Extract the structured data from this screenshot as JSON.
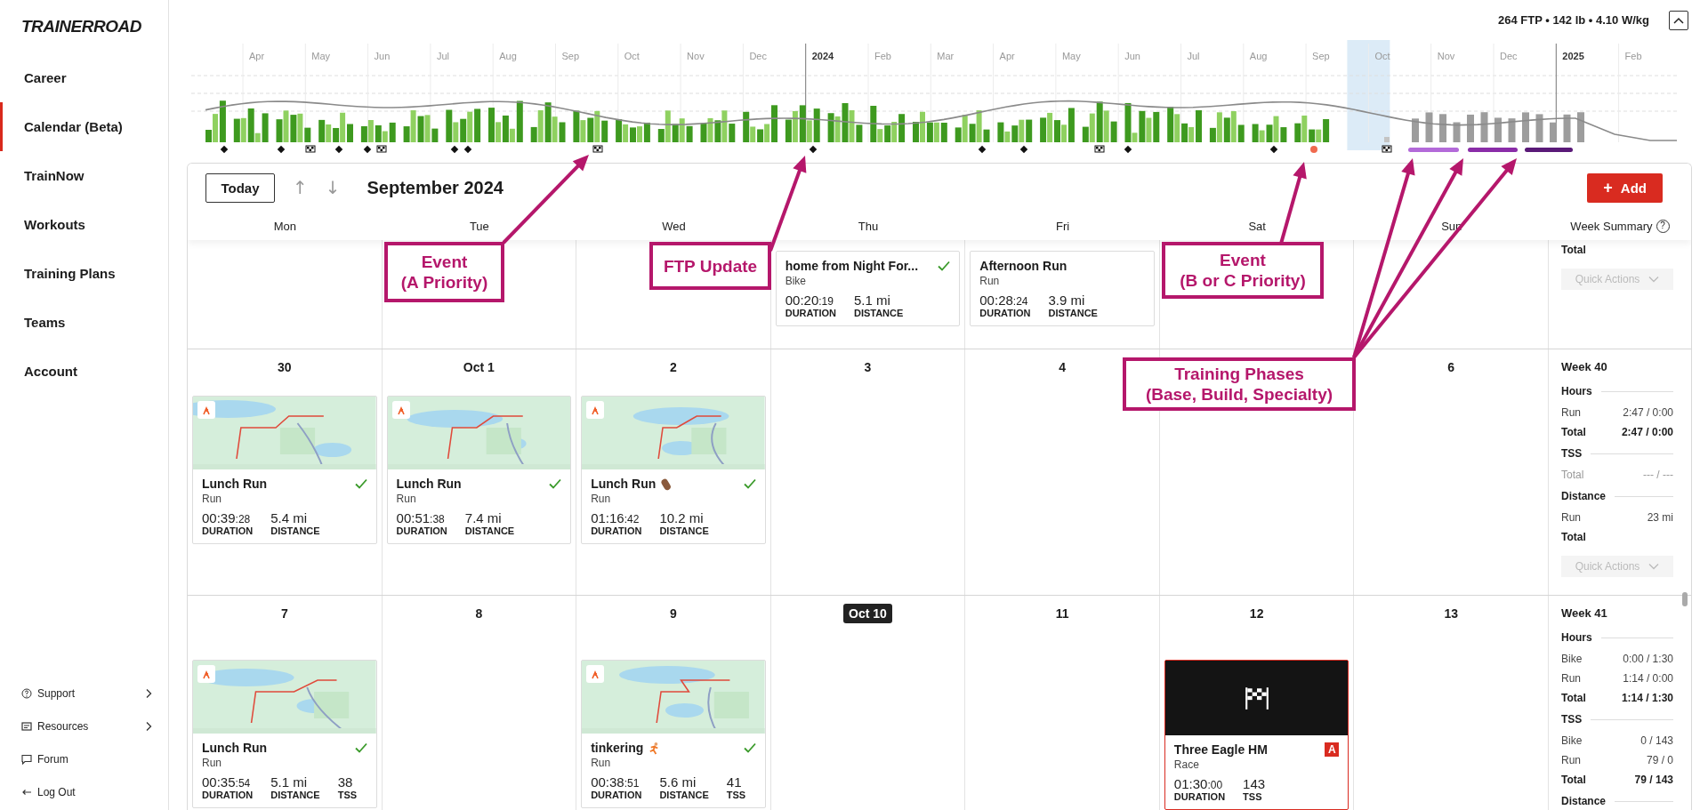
{
  "sidebar": {
    "logo": "TRAINERROAD",
    "nav": [
      {
        "label": "Career",
        "selected": false
      },
      {
        "label": "Calendar (Beta)",
        "selected": true
      },
      {
        "label": "TrainNow",
        "selected": false
      },
      {
        "label": "Workouts",
        "selected": false
      },
      {
        "label": "Training Plans",
        "selected": false
      },
      {
        "label": "Teams",
        "selected": false
      },
      {
        "label": "Account",
        "selected": false
      }
    ],
    "footer": [
      {
        "label": "Support",
        "kind": "help",
        "expandable": true
      },
      {
        "label": "Resources",
        "kind": "resources",
        "expandable": true
      },
      {
        "label": "Forum",
        "kind": "forum",
        "expandable": false
      },
      {
        "label": "Log Out",
        "kind": "logout",
        "expandable": false
      }
    ]
  },
  "header": {
    "stats": "264 FTP • 142 lb • 4.10 W/kg"
  },
  "timeline": {
    "months": [
      {
        "label": "Apr",
        "kind": "month",
        "selected": false
      },
      {
        "label": "May",
        "kind": "month",
        "selected": false
      },
      {
        "label": "Jun",
        "kind": "month",
        "selected": false
      },
      {
        "label": "Jul",
        "kind": "month",
        "selected": false
      },
      {
        "label": "Aug",
        "kind": "month",
        "selected": false
      },
      {
        "label": "Sep",
        "kind": "month",
        "selected": false
      },
      {
        "label": "Oct",
        "kind": "month",
        "selected": false
      },
      {
        "label": "Nov",
        "kind": "month",
        "selected": false
      },
      {
        "label": "Dec",
        "kind": "month",
        "selected": false
      },
      {
        "label": "2024",
        "kind": "year",
        "selected": false
      },
      {
        "label": "Feb",
        "kind": "month",
        "selected": false
      },
      {
        "label": "Mar",
        "kind": "month",
        "selected": false
      },
      {
        "label": "Apr",
        "kind": "month",
        "selected": false
      },
      {
        "label": "May",
        "kind": "month",
        "selected": false
      },
      {
        "label": "Jun",
        "kind": "month",
        "selected": false
      },
      {
        "label": "Jul",
        "kind": "month",
        "selected": false
      },
      {
        "label": "Aug",
        "kind": "month",
        "selected": false
      },
      {
        "label": "Sep",
        "kind": "month",
        "selected": false
      },
      {
        "label": "Oct",
        "kind": "month",
        "selected": true
      },
      {
        "label": "Nov",
        "kind": "month",
        "selected": false
      },
      {
        "label": "Dec",
        "kind": "month",
        "selected": false
      },
      {
        "label": "2025",
        "kind": "year",
        "selected": false
      },
      {
        "label": "Feb",
        "kind": "month",
        "selected": false
      }
    ]
  },
  "annotations": [
    {
      "text": "Event\n(A Priority)"
    },
    {
      "text": "FTP Update"
    },
    {
      "text": "Event\n(B or C Priority)"
    },
    {
      "text": "Training Phases\n(Base, Build, Specialty)"
    }
  ],
  "calendar": {
    "today_button": "Today",
    "prev": "↑",
    "next": "↓",
    "title": "September 2024",
    "add_icon": "+",
    "add_button": "Add",
    "weekdays": [
      "Mon",
      "Tue",
      "Wed",
      "Thu",
      "Fri",
      "Sat",
      "Sun"
    ],
    "summary_heading": "Week Summary",
    "help": "?",
    "weeks": [
      {
        "days": [
          {
            "today": false
          },
          {
            "today": false
          },
          {
            "today": false
          },
          {
            "today": false,
            "items": [
              {
                "kind": "activity",
                "title": "home from Night For...",
                "sport": "Bike",
                "completed": true,
                "stats": [
                  {
                    "kind": "time",
                    "value": "00:20:19",
                    "label": "DURATION"
                  },
                  {
                    "kind": "plain",
                    "value": "5.1 mi",
                    "label": "DISTANCE"
                  }
                ]
              }
            ]
          },
          {
            "today": false,
            "items": [
              {
                "kind": "activity",
                "title": "Afternoon Run",
                "sport": "Run",
                "completed": false,
                "stats": [
                  {
                    "kind": "time",
                    "value": "00:28:24",
                    "label": "DURATION"
                  },
                  {
                    "kind": "plain",
                    "value": "3.9 mi",
                    "label": "DISTANCE"
                  }
                ]
              }
            ]
          },
          {
            "today": false
          },
          {
            "today": false
          }
        ],
        "summary": [
          {
            "kind": "total",
            "label": "Total"
          }
        ],
        "quick_actions": {
          "label": "Quick Actions",
          "disabled": true
        }
      },
      {
        "days": [
          {
            "date": "30",
            "today": false,
            "items": [
              {
                "kind": "activity",
                "map": true,
                "title": "Lunch Run",
                "sport": "Run",
                "completed": true,
                "stats": [
                  {
                    "kind": "time",
                    "value": "00:39:28",
                    "label": "DURATION"
                  },
                  {
                    "kind": "plain",
                    "value": "5.4 mi",
                    "label": "DISTANCE"
                  }
                ]
              }
            ]
          },
          {
            "date": "Oct 1",
            "today": false,
            "items": [
              {
                "kind": "activity",
                "map": true,
                "title": "Lunch Run",
                "sport": "Run",
                "completed": true,
                "stats": [
                  {
                    "kind": "time",
                    "value": "00:51:38",
                    "label": "DURATION"
                  },
                  {
                    "kind": "plain",
                    "value": "7.4 mi",
                    "label": "DISTANCE"
                  }
                ]
              }
            ]
          },
          {
            "date": "2",
            "today": false,
            "items": [
              {
                "kind": "activity",
                "map": true,
                "title": "Lunch Run",
                "sport": "Run",
                "completed": true,
                "stats": [
                  {
                    "kind": "time",
                    "value": "01:16:42",
                    "label": "DURATION"
                  },
                  {
                    "kind": "plain",
                    "value": "10.2 mi",
                    "label": "DISTANCE"
                  }
                ]
              }
            ]
          },
          {
            "date": "3",
            "today": false
          },
          {
            "date": "4",
            "today": false
          },
          {
            "today": false
          },
          {
            "date": "6",
            "today": false
          }
        ],
        "summary": [
          {
            "kind": "title",
            "label": "Week 40"
          },
          {
            "kind": "heading",
            "label": "Hours"
          },
          {
            "kind": "row",
            "label": "Run",
            "value": "2:47 / 0:00"
          },
          {
            "kind": "total",
            "label": "Total",
            "value": "2:47 / 0:00"
          },
          {
            "kind": "heading",
            "label": "TSS"
          },
          {
            "kind": "muted",
            "label": "Total",
            "value": "--- / ---"
          },
          {
            "kind": "heading",
            "label": "Distance"
          },
          {
            "kind": "row",
            "label": "Run",
            "value": "23 mi"
          },
          {
            "kind": "total",
            "label": "Total"
          }
        ],
        "quick_actions": {
          "label": "Quick Actions",
          "disabled": true
        }
      },
      {
        "days": [
          {
            "date": "7",
            "today": false,
            "items": [
              {
                "kind": "activity",
                "map": true,
                "title": "Lunch Run",
                "sport": "Run",
                "completed": true,
                "stats": [
                  {
                    "kind": "time",
                    "value": "00:35:54",
                    "label": "DURATION"
                  },
                  {
                    "kind": "plain",
                    "value": "5.1 mi",
                    "label": "DISTANCE"
                  },
                  {
                    "kind": "plain",
                    "value": "38",
                    "label": "TSS"
                  }
                ]
              }
            ]
          },
          {
            "date": "8",
            "today": false
          },
          {
            "date": "9",
            "today": false,
            "items": [
              {
                "kind": "activity",
                "map": true,
                "title": "tinkering",
                "sport": "Run",
                "completed": true,
                "stats": [
                  {
                    "kind": "time",
                    "value": "00:38:51",
                    "label": "DURATION"
                  },
                  {
                    "kind": "plain",
                    "value": "5.6 mi",
                    "label": "DISTANCE"
                  },
                  {
                    "kind": "plain",
                    "value": "41",
                    "label": "TSS"
                  }
                ]
              }
            ]
          },
          {
            "date": "Oct 10",
            "today": true
          },
          {
            "date": "11",
            "today": false
          },
          {
            "date": "12",
            "today": false,
            "items": [
              {
                "kind": "race",
                "title": "Three Eagle HM",
                "priority": "A",
                "sport": "Race",
                "stats": [
                  {
                    "kind": "time",
                    "value": "01:30:00",
                    "label": "DURATION"
                  },
                  {
                    "kind": "plain",
                    "value": "143",
                    "label": "TSS"
                  }
                ]
              }
            ]
          },
          {
            "date": "13",
            "today": false
          }
        ],
        "summary": [
          {
            "kind": "title",
            "label": "Week 41"
          },
          {
            "kind": "heading",
            "label": "Hours"
          },
          {
            "kind": "row",
            "label": "Bike",
            "value": "0:00 / 1:30"
          },
          {
            "kind": "row",
            "label": "Run",
            "value": "1:14 / 0:00"
          },
          {
            "kind": "total",
            "label": "Total",
            "value": "1:14 / 1:30"
          },
          {
            "kind": "heading",
            "label": "TSS"
          },
          {
            "kind": "row",
            "label": "Bike",
            "value": "0 / 143"
          },
          {
            "kind": "row",
            "label": "Run",
            "value": "79 / 0"
          },
          {
            "kind": "total",
            "label": "Total",
            "value": "79 / 143"
          },
          {
            "kind": "heading",
            "label": "Distance"
          }
        ]
      }
    ]
  }
}
